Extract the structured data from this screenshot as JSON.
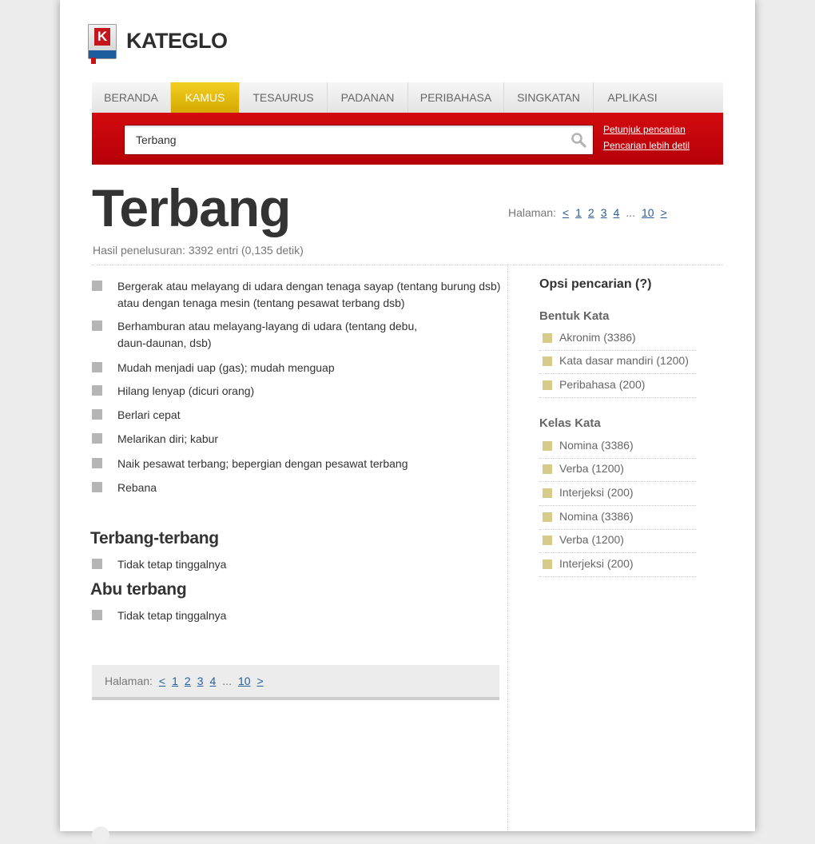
{
  "brand": {
    "name": "KATEGLO",
    "logo_letter": "K"
  },
  "nav": [
    {
      "label": "BERANDA",
      "active": false
    },
    {
      "label": "KAMUS",
      "active": true
    },
    {
      "label": "TESAURUS",
      "active": false
    },
    {
      "label": "PADANAN",
      "active": false
    },
    {
      "label": "PERIBAHASA",
      "active": false
    },
    {
      "label": "SINGKATAN",
      "active": false
    },
    {
      "label": "APLIKASI",
      "active": false
    }
  ],
  "search": {
    "value": "Terbang",
    "links": [
      "Petunjuk pencarian",
      "Pencarian lebih detil"
    ]
  },
  "title": "Terbang",
  "result_info": "Hasil penelusuran: 3392 entri (0,135 detik)",
  "pager": {
    "label": "Halaman:",
    "prev": "<",
    "pages": [
      "1",
      "2",
      "3",
      "4"
    ],
    "ellipsis": "...",
    "last": "10",
    "next": ">"
  },
  "definitions": [
    "Bergerak atau melayang di udara dengan tenaga sayap (tentang burung dsb) atau dengan tenaga mesin (tentang pesawat terbang dsb)",
    "Berhamburan atau melayang-layang di udara (tentang debu, daun-daunan, dsb)",
    "Mudah menjadi uap (gas); mudah menguap",
    "Hilang lenyap (dicuri orang)",
    "Berlari cepat",
    "Melarikan diri; kabur",
    "Naik pesawat terbang; bepergian dengan pesawat terbang",
    "Rebana"
  ],
  "subentries": [
    {
      "title": "Terbang-terbang",
      "definition": "Tidak tetap tinggalnya"
    },
    {
      "title": "Abu terbang",
      "definition": "Tidak tetap tinggalnya"
    }
  ],
  "sidebar": {
    "title": "Opsi pencarian (?)",
    "groups": [
      {
        "heading": "Bentuk Kata",
        "items": [
          "Akronim (3386)",
          "Kata dasar mandiri (1200)",
          "Peribahasa (200)"
        ]
      },
      {
        "heading": "Kelas Kata",
        "items": [
          "Nomina (3386)",
          "Verba (1200)",
          "Interjeksi (200)",
          "Nomina (3386)",
          "Verba (1200)",
          "Interjeksi (200)"
        ]
      }
    ]
  },
  "colors": {
    "accent_red": "#c4141c",
    "active_tab": "#e0b80a",
    "link_blue": "#2a5e9c",
    "checkbox": "#d6cb88"
  }
}
